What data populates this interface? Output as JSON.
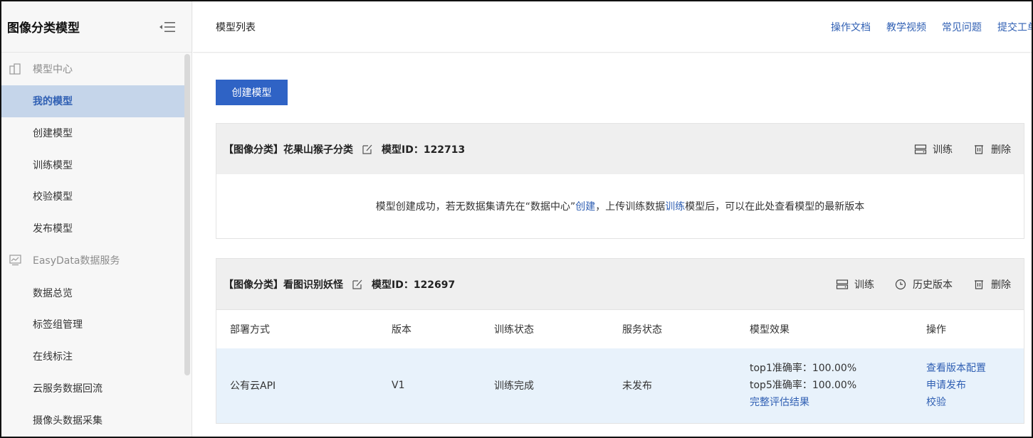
{
  "sidebar": {
    "title": "图像分类模型",
    "groups": [
      {
        "label": "模型中心",
        "items": [
          "我的模型",
          "创建模型",
          "训练模型",
          "校验模型",
          "发布模型"
        ]
      },
      {
        "label": "EasyData数据服务",
        "items": [
          "数据总览",
          "标签组管理",
          "在线标注",
          "云服务数据回流",
          "摄像头数据采集"
        ]
      }
    ],
    "active_item": "我的模型"
  },
  "topbar": {
    "breadcrumb": "模型列表",
    "links": [
      "操作文档",
      "教学视频",
      "常见问题",
      "提交工单"
    ]
  },
  "main": {
    "create_button": "创建模型",
    "cards": [
      {
        "title": "【图像分类】花果山猴子分类",
        "model_id": "模型ID：122713",
        "actions": [
          "训练",
          "删除"
        ],
        "message": {
          "part1": "模型创建成功，若无数据集请先在“数据中心”",
          "link1": "创建",
          "part2": "，上传训练数据",
          "link2": "训练",
          "part3": "模型后，可以在此处查看模型的最新版本"
        }
      },
      {
        "title": "【图像分类】看图识别妖怪",
        "model_id": "模型ID：122697",
        "actions": [
          "训练",
          "历史版本",
          "删除"
        ],
        "table": {
          "headers": [
            "部署方式",
            "版本",
            "训练状态",
            "服务状态",
            "模型效果",
            "操作"
          ],
          "row": {
            "deploy": "公有云API",
            "version": "V1",
            "train_status": "训练完成",
            "service_status": "未发布",
            "effect": [
              "top1准确率：100.00%",
              "top5准确率：100.00%"
            ],
            "effect_link": "完整评估结果",
            "ops": [
              "查看版本配置",
              "申请发布",
              "校验"
            ]
          }
        }
      }
    ]
  },
  "colors": {
    "accent": "#2f63c5",
    "link": "#2f5fb3",
    "active_bg": "#c5d5ea",
    "row_bg": "#e8f2fb"
  }
}
